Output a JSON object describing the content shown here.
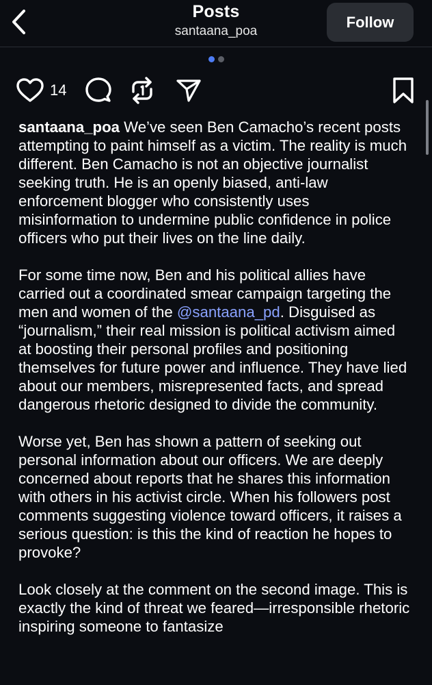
{
  "header": {
    "title": "Posts",
    "subtitle": "santaana_poa",
    "follow_label": "Follow"
  },
  "carousel": {
    "active_index": 1,
    "total": 2
  },
  "actions": {
    "like_icon": "heart-icon",
    "like_count": "14",
    "comment_icon": "comment-icon",
    "repost_icon": "repost-icon",
    "share_icon": "send-icon",
    "save_icon": "bookmark-icon"
  },
  "post": {
    "username": "santaana_poa",
    "p1_text": " We’ve seen Ben Camacho’s recent posts attempting to paint himself as a victim. The reality is much different. Ben Camacho is not an objective journalist seeking truth. He is an openly biased, anti-law enforcement blogger who consistently uses misinformation to undermine public confidence in police officers who put their lives on the line daily.",
    "p2_before": "For some time now, Ben and his political allies have carried out a coordinated smear campaign targeting the men and women of the ",
    "p2_mention": "@santaana_pd",
    "p2_after": ". Disguised as “journalism,” their real mission is political activism aimed at boosting their personal profiles and positioning themselves for future power and influence. They have lied about our members, misrepresented facts, and spread dangerous rhetoric designed to divide the community.",
    "p3_text": "Worse yet, Ben has shown a pattern of seeking out personal information about our officers. We are deeply concerned about reports that he shares this information with others in his activist circle. When his followers post comments suggesting violence toward officers, it raises a serious question: is this the kind of reaction he hopes to provoke?",
    "p4_text": "Look closely at the comment on the second image. This is exactly the kind of threat we feared—irresponsible rhetoric inspiring someone to fantasize"
  },
  "colors": {
    "background": "#0b0d12",
    "mention": "#8aa2ff",
    "active_dot": "#4d7cf4",
    "follow_button": "#2a2d33"
  }
}
